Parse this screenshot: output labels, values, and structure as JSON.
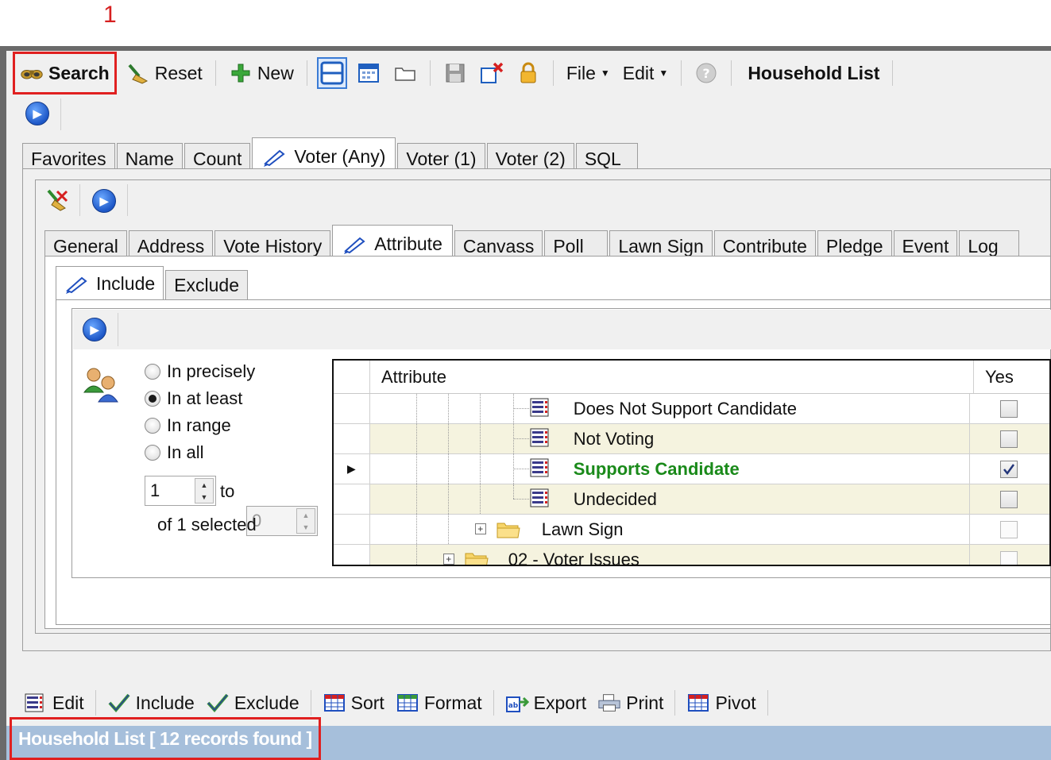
{
  "callout": {
    "number": "1"
  },
  "toolbar": {
    "search_label": "Search",
    "reset_label": "Reset",
    "new_label": "New",
    "file_label": "File",
    "edit_label": "Edit",
    "title": "Household List"
  },
  "main_tabs": [
    {
      "label": "Favorites"
    },
    {
      "label": "Name"
    },
    {
      "label": "Count"
    },
    {
      "label": "Voter (Any)"
    },
    {
      "label": "Voter (1)"
    },
    {
      "label": "Voter (2)"
    },
    {
      "label": "SQL"
    }
  ],
  "sub_tabs": [
    {
      "label": "General"
    },
    {
      "label": "Address"
    },
    {
      "label": "Vote History"
    },
    {
      "label": "Attribute"
    },
    {
      "label": "Canvass"
    },
    {
      "label": "Poll"
    },
    {
      "label": "Lawn Sign"
    },
    {
      "label": "Contribute"
    },
    {
      "label": "Pledge"
    },
    {
      "label": "Event"
    },
    {
      "label": "Log"
    }
  ],
  "inner_tabs": [
    {
      "label": "Include"
    },
    {
      "label": "Exclude"
    }
  ],
  "match_options": {
    "selected": "In at least",
    "options": [
      {
        "label": "In precisely"
      },
      {
        "label": "In at least"
      },
      {
        "label": "In range"
      },
      {
        "label": "In all"
      }
    ],
    "range_from": "1",
    "range_to_label": "to",
    "range_to": "0",
    "selected_summary": "of 1 selected"
  },
  "attribute_grid": {
    "col_attribute": "Attribute",
    "col_yes": "Yes",
    "rows": [
      {
        "label": "Does Not Support Candidate",
        "checked": false
      },
      {
        "label": "Not Voting",
        "checked": false
      },
      {
        "label": "Supports Candidate",
        "checked": true
      },
      {
        "label": "Undecided",
        "checked": false
      },
      {
        "label": "Lawn Sign",
        "checked": false
      },
      {
        "label": "02 - Voter Issues",
        "checked": false
      }
    ]
  },
  "bottom_toolbar": {
    "edit_label": "Edit",
    "include_label": "Include",
    "exclude_label": "Exclude",
    "sort_label": "Sort",
    "format_label": "Format",
    "export_label": "Export",
    "print_label": "Print",
    "pivot_label": "Pivot"
  },
  "status": {
    "text": "Household List [ 12 records found ]"
  },
  "colors": {
    "callout_red": "#e02020",
    "highlight_green": "#1a8a1a",
    "status_blue": "#a6bfdb",
    "row_alt": "#f5f3df"
  }
}
